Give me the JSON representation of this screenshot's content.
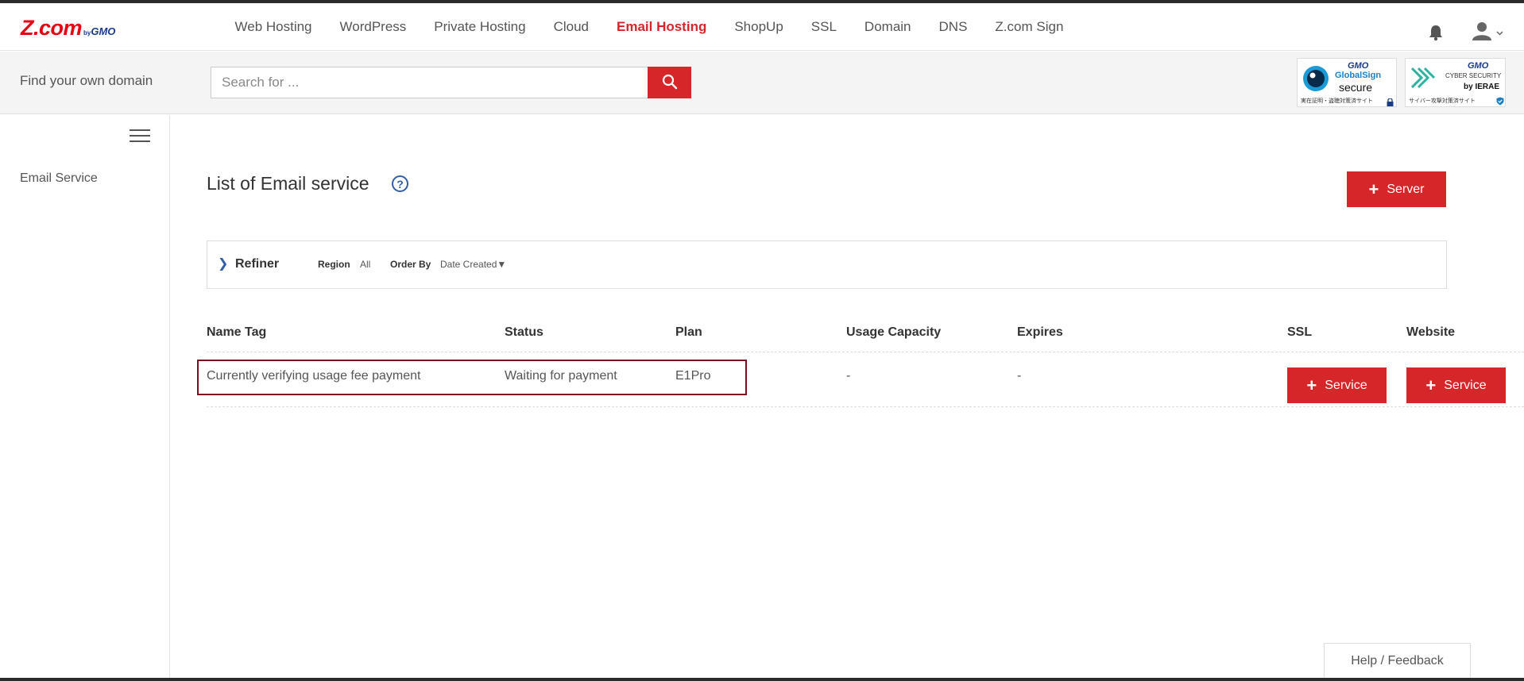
{
  "header": {
    "logo_main": "Z.com",
    "logo_by": "by",
    "logo_gmo": "GMO",
    "nav": [
      {
        "label": "Web Hosting",
        "active": false
      },
      {
        "label": "WordPress",
        "active": false
      },
      {
        "label": "Private Hosting",
        "active": false
      },
      {
        "label": "Cloud",
        "active": false
      },
      {
        "label": "Email Hosting",
        "active": true
      },
      {
        "label": "ShopUp",
        "active": false
      },
      {
        "label": "SSL",
        "active": false
      },
      {
        "label": "Domain",
        "active": false
      },
      {
        "label": "DNS",
        "active": false
      },
      {
        "label": "Z.com Sign",
        "active": false
      }
    ],
    "icons": [
      "bell-icon",
      "user-icon",
      "chevron-down-icon"
    ]
  },
  "search": {
    "label": "Find your own domain",
    "placeholder": "Search for ...",
    "value": "",
    "button_icon": "search-icon"
  },
  "badges": {
    "globalsign": {
      "gmo": "GMO",
      "name": "GlobalSign",
      "secure": "secure",
      "sub": "実在証明・盗聴対策済サイト"
    },
    "cybersecurity": {
      "gmo": "GMO",
      "name": "CYBER SECURITY",
      "by": "by IERAE",
      "sub": "サイバー攻撃対策済サイト"
    }
  },
  "sidebar": {
    "items": [
      {
        "label": "Email Service"
      }
    ]
  },
  "main": {
    "title": "List of Email service",
    "help_icon": "?",
    "add_server_label": "Server",
    "refiner": {
      "label": "Refiner",
      "region_key": "Region",
      "region_value": "All",
      "order_key": "Order By",
      "order_value": "Date Created▼"
    },
    "table": {
      "columns": [
        "Name Tag",
        "Status",
        "Plan",
        "Usage Capacity",
        "Expires",
        "SSL",
        "Website"
      ],
      "rows": [
        {
          "name_tag": "Currently verifying usage fee payment",
          "status": "Waiting for payment",
          "plan": "E1Pro",
          "usage_capacity": "-",
          "expires": "-",
          "ssl_button": "Service",
          "website_button": "Service"
        }
      ]
    }
  },
  "footer": {
    "feedback_label": "Help / Feedback"
  },
  "colors": {
    "accent_red": "#d6262a",
    "help_blue": "#2f5fa7",
    "highlight_border": "#7b1020"
  }
}
